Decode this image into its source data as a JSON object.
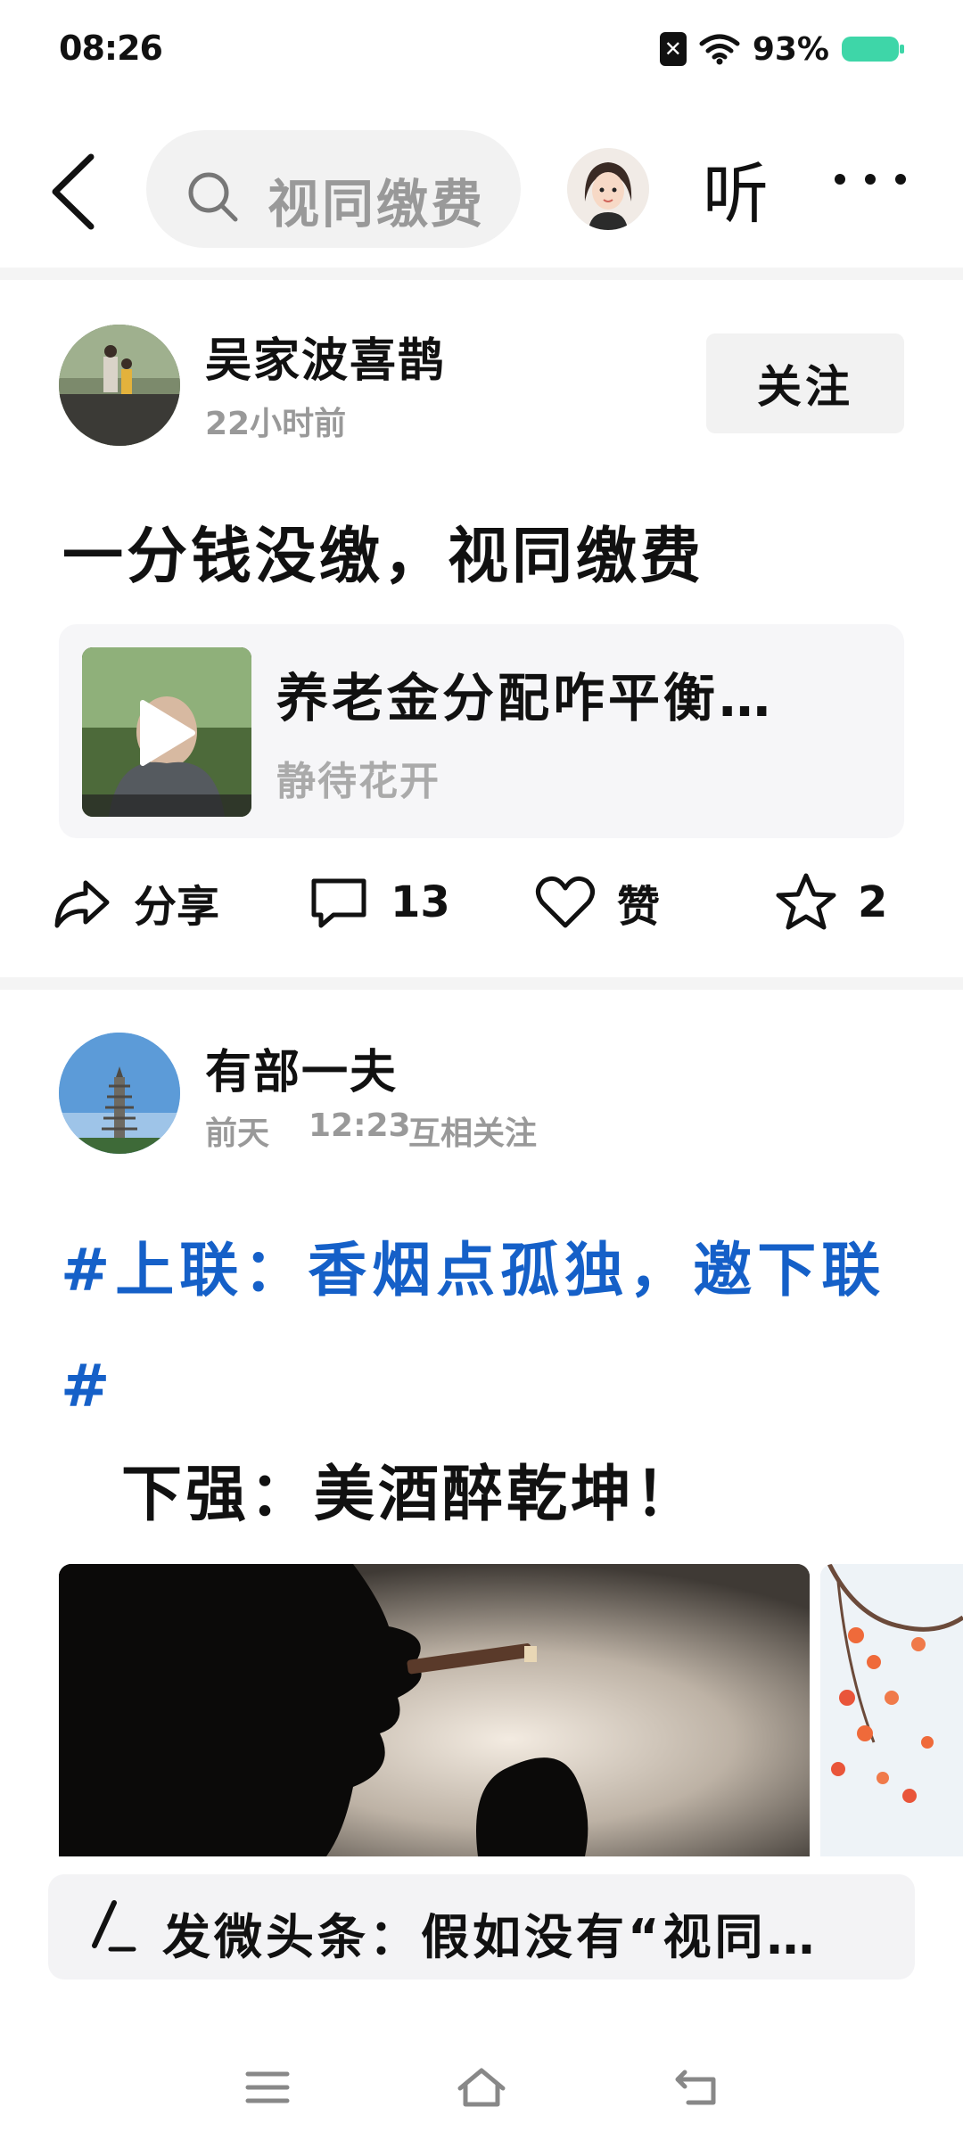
{
  "status_bar": {
    "time": "08:26",
    "battery_percent": "93%",
    "battery_color": "#3ed6a8"
  },
  "top_nav": {
    "search_text": "视同缴费",
    "listen_label": "听"
  },
  "post1": {
    "author": "吴家波喜鹊",
    "time": "22小时前",
    "follow_label": "关注",
    "title": "一分钱没缴，视同缴费",
    "quote": {
      "title": "养老金分配咋平衡…",
      "author": "静待花开"
    },
    "actions": {
      "share_label": "分享",
      "comment_count": "13",
      "like_label": "赞",
      "favorite_count": "2"
    }
  },
  "post2": {
    "author": "有部一夫",
    "date": "前天",
    "time": "12:23",
    "relation": "互相关注",
    "topic": "#上联：香烟点孤独，邀下联#",
    "body": "下强：美酒醉乾坤！"
  },
  "composer": {
    "text": "发微头条：假如没有“视同…"
  },
  "colors": {
    "topic_blue": "#1560c8",
    "muted_gray": "#999999"
  }
}
